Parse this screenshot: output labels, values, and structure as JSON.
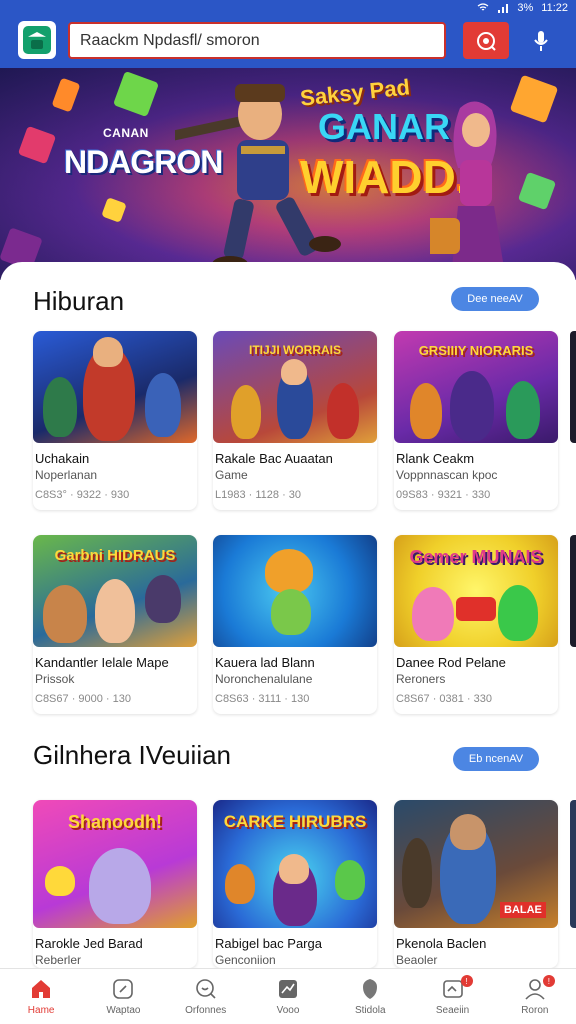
{
  "status_bar": {
    "battery": "3%",
    "time": "11:22"
  },
  "header": {
    "search_text": "Raackm Npdasfl/ smoron",
    "icons": [
      "app-logo-icon",
      "record-icon",
      "mic-icon"
    ]
  },
  "banner": {
    "brand_small": "CANAN",
    "brand": "NDAGRON",
    "game_title_top": "Saksy Pad",
    "game_title_mid": "GANAR",
    "game_title_bottom": "WIADD.!"
  },
  "sections": [
    {
      "title": "Hiburan",
      "see_all": "Dee neeAV",
      "cards": [
        {
          "name": "Uchakain",
          "sub": "Noperlanan",
          "meta": "C8S3° · 9322 · 930"
        },
        {
          "name": "Rakale Bac Auaatan",
          "sub": "Game",
          "meta": "L1983 · 1128 · 30"
        },
        {
          "name": "Rlank Ceakm",
          "sub": "Voppnnascan kpoc",
          "meta": "09S83 · 9321 · 330"
        },
        {
          "name": "Kandantler Ielale Mape",
          "sub": "Prissok",
          "meta": "C8S67 · 9000 · 130",
          "art": "Garbni HIDRAUS"
        },
        {
          "name": "Kauera lad Blann",
          "sub": "Noronchenalulane",
          "meta": "C8S63 · 3111 · 130"
        },
        {
          "name": "Danee Rod Pelane",
          "sub": "Reroners",
          "meta": "C8S67 · 0381 · 330",
          "art": "Gemer MUNAIS"
        }
      ]
    },
    {
      "title": "Gilnhera IVeuiian",
      "see_all": "Eb ncenAV",
      "cards": [
        {
          "name": "Rarokle Jed Barad",
          "sub": "Reberler",
          "art": "Shanoodh!"
        },
        {
          "name": "Rabigel bac Parga",
          "sub": "Genconiion",
          "art": "CARKE HIRUBRS"
        },
        {
          "name": "Pkenola Baclen",
          "sub": "Beaoler",
          "art": "BALAE"
        }
      ]
    }
  ],
  "card_art": {
    "s1c2": "ITIJJI WORRAIS",
    "s1c3": "GRSIIIY NIORARIS"
  },
  "bottom_nav": [
    {
      "label": "Hame",
      "icon": "home-icon",
      "active": true
    },
    {
      "label": "Waptao",
      "icon": "tablet-icon"
    },
    {
      "label": "Orfonnes",
      "icon": "chat-search-icon"
    },
    {
      "label": "Vooo",
      "icon": "chart-icon"
    },
    {
      "label": "Stidola",
      "icon": "shield-icon"
    },
    {
      "label": "Seaeiin",
      "icon": "notes-icon",
      "badge": "!"
    },
    {
      "label": "Roron",
      "icon": "profile-icon",
      "badge": "!"
    }
  ],
  "colors": {
    "header_blue": "#2b56c6",
    "accent_red": "#e23b35",
    "pill_blue": "#4c86e3"
  }
}
